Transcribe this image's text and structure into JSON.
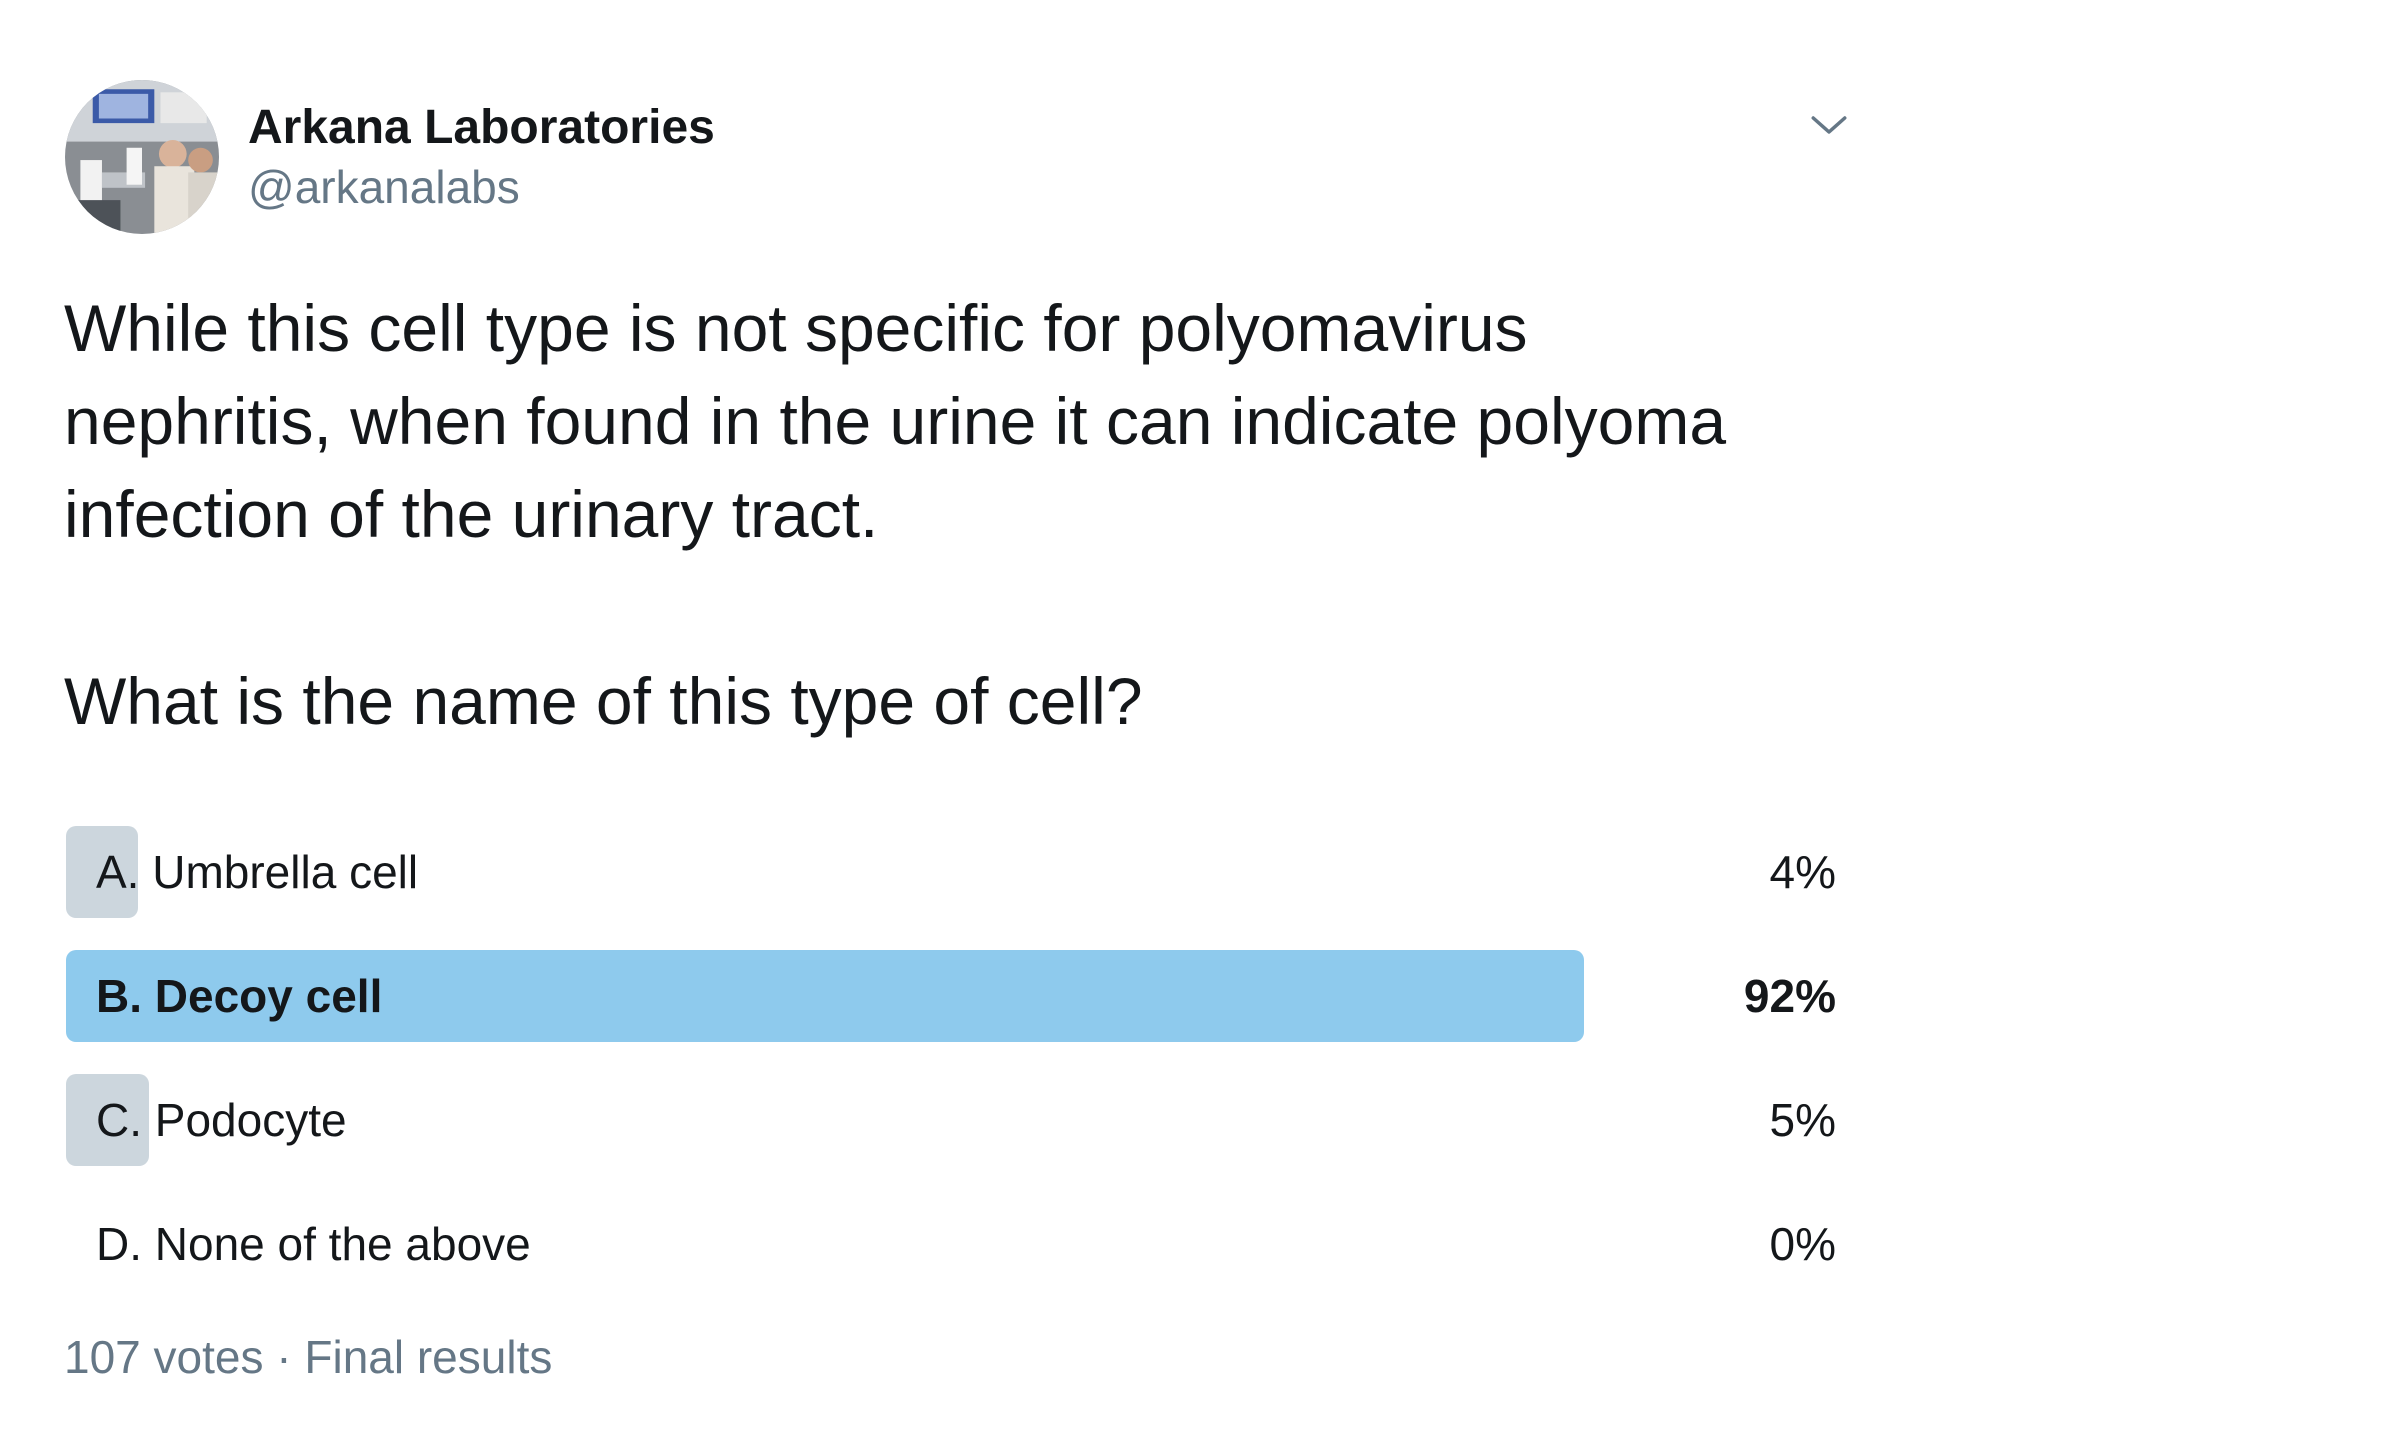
{
  "author": {
    "display_name": "Arkana Laboratories",
    "handle": "@arkanalabs",
    "avatar_icon": "profile-photo"
  },
  "tweet": {
    "text_lines": [
      "While this cell type is not specific for polyomavirus",
      "nephritis, when found in the urine it can indicate polyoma",
      "infection of the urinary tract."
    ],
    "question": "What is the name of this type of cell?"
  },
  "poll": {
    "options": [
      {
        "label": "A. Umbrella cell",
        "percent_text": "4%",
        "percent": 4,
        "winner": false
      },
      {
        "label": "B. Decoy cell",
        "percent_text": "92%",
        "percent": 92,
        "winner": true
      },
      {
        "label": "C. Podocyte",
        "percent_text": "5%",
        "percent": 5,
        "winner": false
      },
      {
        "label": "D. None of the above",
        "percent_text": "0%",
        "percent": 0,
        "winner": false
      }
    ],
    "votes": "107 votes",
    "separator": "·",
    "status": "Final results"
  },
  "colors": {
    "bar_default": "#ccd6dd",
    "bar_winner": "#8ecaed",
    "text_primary": "#14171a",
    "text_secondary": "#657786"
  }
}
